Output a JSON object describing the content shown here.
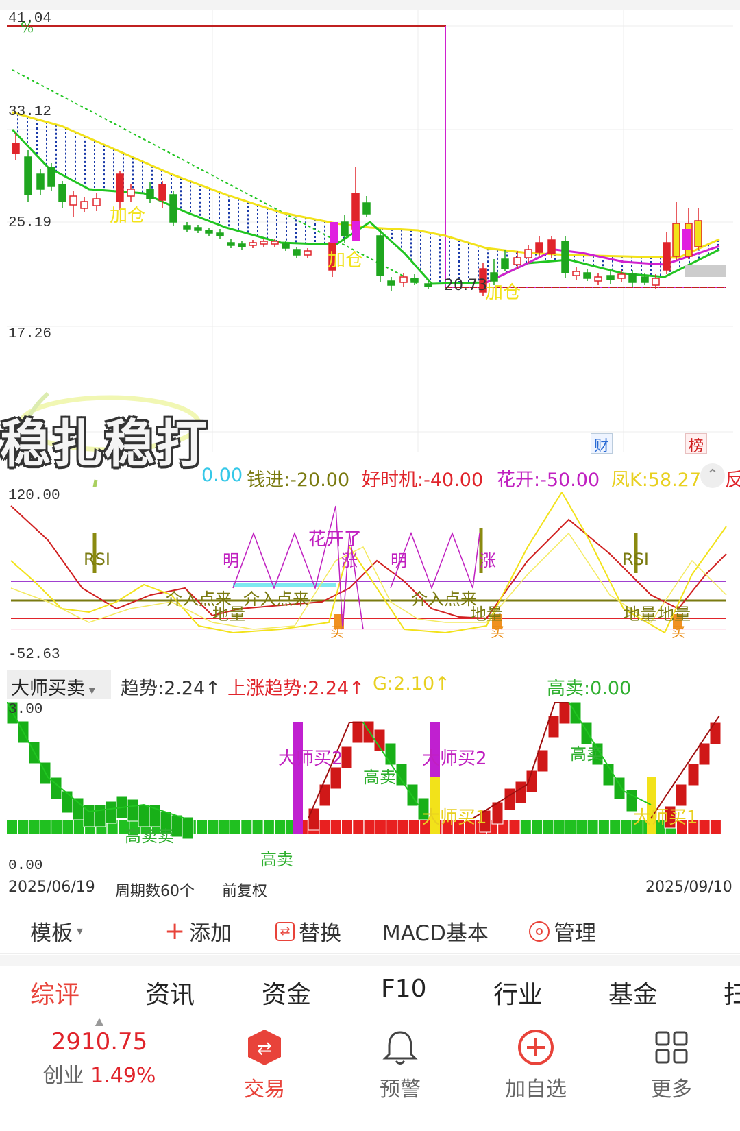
{
  "main_chart": {
    "y_ticks": [
      "41.04",
      "33.12",
      "25.19",
      "17.26"
    ],
    "percent_symbol": "%",
    "signals": [
      "加仓",
      "加仓",
      "加仓"
    ],
    "price_label": "20.73",
    "corner_badges": [
      "财",
      "榜"
    ]
  },
  "indicator_row": {
    "items": [
      {
        "text": "0.00",
        "color": "#36c8e8"
      },
      {
        "text": "钱进:-20.00",
        "color": "#7a7a10"
      },
      {
        "text": "好时机:-40.00",
        "color": "#e0242b"
      },
      {
        "text": "花开:-50.00",
        "color": "#c020c0"
      },
      {
        "text": "凤K:58.27",
        "color": "#e8d020"
      },
      {
        "text": "反",
        "color": "#e0242b"
      }
    ],
    "expand_icon": "chevron-up-icon"
  },
  "indicator_panel": {
    "y_max": "120.00",
    "y_min": "-52.63",
    "labels": {
      "rsi": "RSI",
      "flower": "花开了",
      "bright": "明",
      "rise": "涨",
      "intervene": "介入点来",
      "ground": "地量",
      "buy": "买"
    }
  },
  "master_row": {
    "selector": "大师买卖",
    "items": [
      {
        "text": "趋势:2.24↑",
        "color": "#333333"
      },
      {
        "text": "上涨趋势:2.24↑",
        "color": "#e0242b"
      },
      {
        "text": "G:2.10↑",
        "color": "#e8d020"
      },
      {
        "text": "高卖:0.00",
        "color": "#30b030"
      }
    ]
  },
  "master_panel": {
    "y_max": "3.00",
    "y_min": "0.00",
    "labels": {
      "buy2": "大师买2",
      "buy1": "大师买1",
      "sell": "高卖",
      "sell_sell": "高卖卖"
    }
  },
  "dates": {
    "start": "2025/06/19",
    "periods": "周期数60个",
    "adjust": "前复权",
    "end": "2025/09/10"
  },
  "toolbar": {
    "template": "模板",
    "add": "添加",
    "replace": "替换",
    "indicator": "MACD基本",
    "manage": "管理"
  },
  "tabs": [
    "综评",
    "资讯",
    "资金",
    "F10",
    "行业",
    "基金",
    "扫"
  ],
  "active_tab": 0,
  "bottom_bar": {
    "index_value": "2910.75",
    "index_name": "创业",
    "index_change": "1.49%",
    "trade": "交易",
    "alert": "预警",
    "add_watch": "加自选",
    "more": "更多"
  },
  "watermark": "稳扎稳打",
  "colors": {
    "up": "#e0242b",
    "down": "#1fa61f",
    "ma_yellow": "#f2e21a",
    "ma_green": "#21c521",
    "magenta": "#d020d0",
    "accent_red": "#e8433a"
  }
}
